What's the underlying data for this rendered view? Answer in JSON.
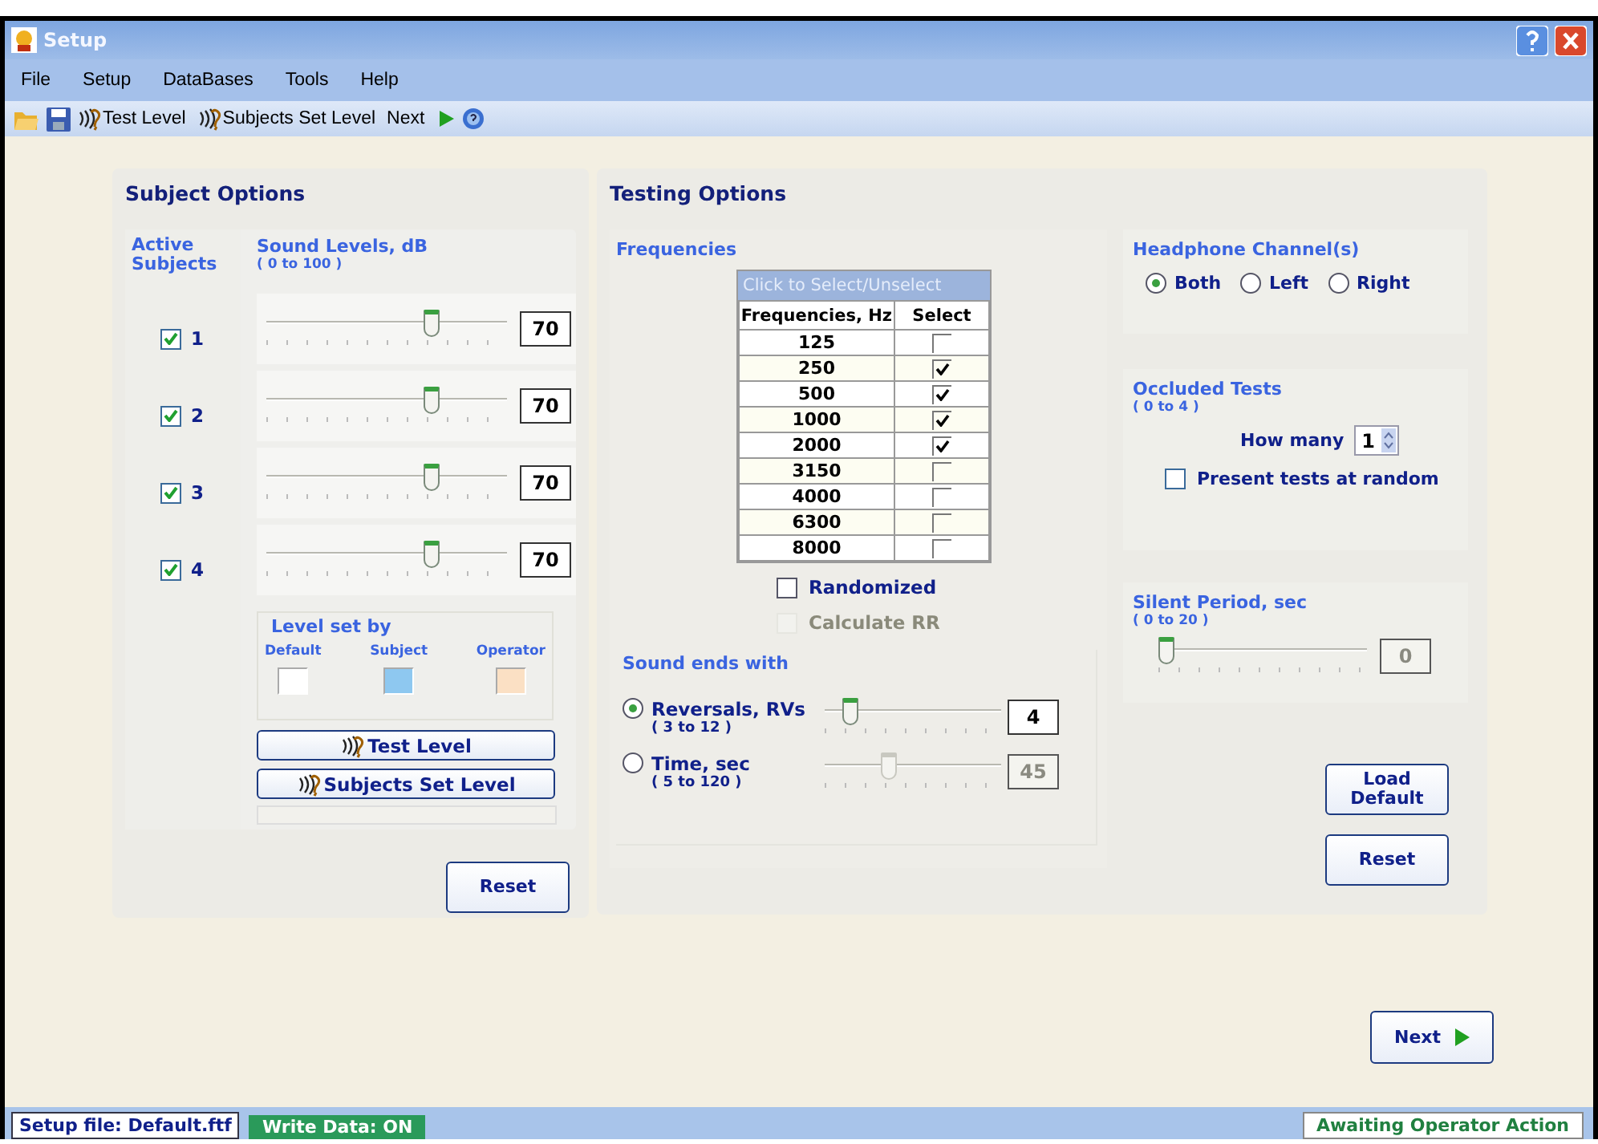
{
  "window": {
    "title": "Setup"
  },
  "menu": [
    {
      "label": "File"
    },
    {
      "label": "Setup"
    },
    {
      "label": "DataBases"
    },
    {
      "label": "Tools"
    },
    {
      "label": "Help"
    }
  ],
  "toolbar": [
    {
      "kind": "open"
    },
    {
      "kind": "save"
    },
    {
      "kind": "ear",
      "label": "Test Level"
    },
    {
      "kind": "ear",
      "label": "Subjects Set Level"
    },
    {
      "kind": "next",
      "label": "Next"
    },
    {
      "kind": "help"
    }
  ],
  "subject_options": {
    "title": "Subject Options",
    "active_label": "Active Subjects",
    "levels_label": "Sound Levels, dB",
    "levels_range": "( 0 to 100 )",
    "subjects": [
      {
        "number": "1",
        "checked": true,
        "level": 0.7,
        "value": "70"
      },
      {
        "number": "2",
        "checked": true,
        "level": 0.7,
        "value": "70"
      },
      {
        "number": "3",
        "checked": true,
        "level": 0.7,
        "value": "70"
      },
      {
        "number": "4",
        "checked": true,
        "level": 0.7,
        "value": "70"
      }
    ],
    "level_set_by": {
      "title": "Level set by",
      "items": [
        {
          "label": "Default",
          "color": "#ffffff"
        },
        {
          "label": "Subject",
          "color": "#8ec8f0"
        },
        {
          "label": "Operator",
          "color": "#fbe0c4"
        }
      ]
    },
    "buttons": [
      {
        "label": "Test Level"
      },
      {
        "label": "Subjects Set Level"
      }
    ],
    "reset": "Reset"
  },
  "testing_options": {
    "title": "Testing Options",
    "frequencies": {
      "title": "Frequencies",
      "table_header": "Click to Select/Unselect",
      "columns": [
        "Frequencies, Hz",
        "Select"
      ],
      "rows": [
        {
          "hz": "125",
          "checked": false
        },
        {
          "hz": "250",
          "checked": true
        },
        {
          "hz": "500",
          "checked": true
        },
        {
          "hz": "1000",
          "checked": true
        },
        {
          "hz": "2000",
          "checked": true
        },
        {
          "hz": "3150",
          "checked": false
        },
        {
          "hz": "4000",
          "checked": false
        },
        {
          "hz": "6300",
          "checked": false
        },
        {
          "hz": "8000",
          "checked": false
        }
      ],
      "options": [
        {
          "label": "Randomized",
          "checked": false,
          "disabled": false
        },
        {
          "label": "Calculate RR",
          "checked": false,
          "disabled": true
        }
      ]
    },
    "sound_ends": {
      "title": "Sound ends with",
      "items": [
        {
          "label": "Reversals, RVs",
          "range": "( 3 to 12 )",
          "selected": true,
          "level": 0.11,
          "value": "4"
        },
        {
          "label": "Time, sec",
          "range": "( 5 to 120 )",
          "selected": false,
          "level": 0.35,
          "value": "45"
        }
      ]
    },
    "headphone": {
      "title": "Headphone Channel(s)",
      "options": [
        {
          "label": "Both",
          "selected": true
        },
        {
          "label": "Left",
          "selected": false
        },
        {
          "label": "Right",
          "selected": false
        }
      ]
    },
    "occluded": {
      "title": "Occluded Tests",
      "range": "( 0 to 4 )",
      "how_many_label": "How many",
      "how_many": "1",
      "random_label": "Present tests at random",
      "random_checked": false
    },
    "silent": {
      "title": "Silent Period, sec",
      "range": "( 0 to 20 )",
      "level": 0,
      "value": "0"
    },
    "load_default": "Load Default",
    "reset": "Reset"
  },
  "next_button": "Next",
  "status_bar": {
    "setup_file": "Setup file: Default.ftf",
    "write_data": "Write Data: ON",
    "status": "Awaiting Operator Action"
  }
}
